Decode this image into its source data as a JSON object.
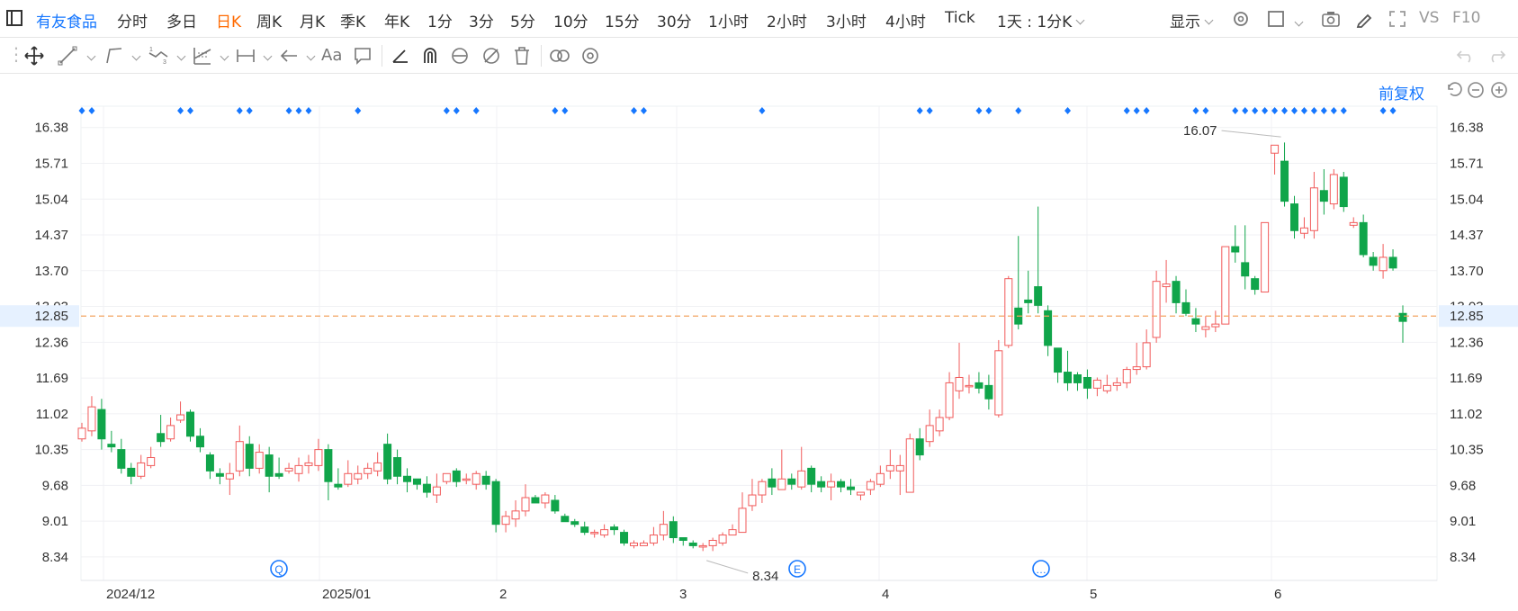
{
  "stock": {
    "name": "有友食品"
  },
  "periods": [
    "分时",
    "多日",
    "日K",
    "周K",
    "月K",
    "季K",
    "年K",
    "1分",
    "3分",
    "5分",
    "10分",
    "15分",
    "30分",
    "1小时",
    "2小时",
    "3小时",
    "4小时",
    "Tick"
  ],
  "active_period": "日K",
  "period_select": "1天 : 1分K",
  "display_label": "显示",
  "vs_label": "VS",
  "f10_label": "F10",
  "adjust_label": "前复权",
  "text_tool_label": "Aa",
  "icons": [
    "sidebar-toggle-icon",
    "settings-icon",
    "rectangle-icon",
    "camera-icon",
    "pencil-icon",
    "fullscreen-icon",
    "undo-icon",
    "redo-icon",
    "crosshair-move-icon",
    "line-icon",
    "channel-icon",
    "wave-icon",
    "fib-icon",
    "measure-icon",
    "arrow-icon",
    "text-icon",
    "comment-icon",
    "angle-icon",
    "magnet-icon",
    "eye-lock-icon",
    "hide-icon",
    "trash-icon",
    "link-icon",
    "gear-icon",
    "reset-icon",
    "zoom-out-icon",
    "zoom-in-icon"
  ],
  "colors": {
    "up": "#f15a5a",
    "down": "#10a54a",
    "accent": "#1677ff",
    "active": "#ff6a00",
    "price_line": "#f4a460"
  },
  "chart_data": {
    "type": "candlestick",
    "y_ticks": [
      "16.38",
      "15.71",
      "15.04",
      "14.37",
      "13.70",
      "13.03",
      "12.36",
      "11.69",
      "11.02",
      "10.35",
      "9.68",
      "9.01",
      "8.34"
    ],
    "ylim": [
      7.9,
      16.78
    ],
    "x_ticks": [
      "2024/12",
      "2025/01",
      "2",
      "3",
      "4",
      "5",
      "6"
    ],
    "current_price": "12.85",
    "high_label": "16.07",
    "low_label": "8.34",
    "event_markers": [
      "Q",
      "E",
      "…"
    ],
    "candles": [
      [
        10.55,
        10.75,
        10.85,
        10.5
      ],
      [
        10.7,
        11.15,
        11.35,
        10.6
      ],
      [
        11.1,
        10.55,
        11.3,
        10.35
      ],
      [
        10.45,
        10.4,
        10.7,
        10.3
      ],
      [
        10.35,
        10.0,
        10.55,
        9.9
      ],
      [
        10.0,
        9.85,
        10.1,
        9.7
      ],
      [
        9.85,
        10.1,
        10.25,
        9.8
      ],
      [
        10.05,
        10.2,
        10.4,
        10.0
      ],
      [
        10.65,
        10.5,
        11.0,
        10.4
      ],
      [
        10.55,
        10.8,
        10.95,
        10.5
      ],
      [
        10.9,
        11.0,
        11.25,
        10.85
      ],
      [
        11.05,
        10.6,
        11.1,
        10.5
      ],
      [
        10.6,
        10.4,
        10.75,
        10.3
      ],
      [
        10.25,
        9.95,
        10.3,
        9.8
      ],
      [
        9.9,
        9.85,
        10.0,
        9.7
      ],
      [
        9.8,
        9.9,
        10.1,
        9.5
      ],
      [
        9.95,
        10.5,
        10.8,
        9.85
      ],
      [
        10.45,
        10.0,
        10.6,
        9.85
      ],
      [
        10.0,
        10.3,
        10.45,
        9.9
      ],
      [
        10.25,
        9.85,
        10.4,
        9.55
      ],
      [
        9.9,
        9.85,
        10.2,
        9.8
      ],
      [
        9.95,
        10.0,
        10.1,
        9.9
      ],
      [
        9.9,
        10.05,
        10.2,
        9.75
      ],
      [
        10.05,
        10.1,
        10.25,
        9.9
      ],
      [
        10.05,
        10.35,
        10.55,
        9.95
      ],
      [
        10.35,
        9.75,
        10.45,
        9.4
      ],
      [
        9.7,
        9.65,
        10.0,
        9.6
      ],
      [
        9.7,
        9.9,
        10.15,
        9.65
      ],
      [
        9.8,
        9.9,
        10.05,
        9.7
      ],
      [
        9.9,
        10.0,
        10.1,
        9.8
      ],
      [
        9.95,
        10.1,
        10.3,
        9.85
      ],
      [
        10.45,
        9.8,
        10.65,
        9.7
      ],
      [
        10.2,
        9.85,
        10.35,
        9.7
      ],
      [
        9.85,
        9.75,
        10.0,
        9.55
      ],
      [
        9.8,
        9.7,
        9.8,
        9.6
      ],
      [
        9.7,
        9.55,
        9.85,
        9.45
      ],
      [
        9.5,
        9.65,
        9.9,
        9.35
      ],
      [
        9.75,
        9.9,
        9.9,
        9.7
      ],
      [
        9.95,
        9.75,
        10.0,
        9.65
      ],
      [
        9.8,
        9.8,
        9.9,
        9.7
      ],
      [
        9.7,
        9.9,
        9.95,
        9.6
      ],
      [
        9.85,
        9.7,
        9.95,
        9.6
      ],
      [
        9.75,
        8.95,
        9.8,
        8.8
      ],
      [
        8.95,
        9.1,
        9.2,
        8.8
      ],
      [
        9.05,
        9.2,
        9.4,
        8.9
      ],
      [
        9.2,
        9.45,
        9.7,
        9.1
      ],
      [
        9.45,
        9.35,
        9.5,
        9.35
      ],
      [
        9.35,
        9.5,
        9.55,
        9.25
      ],
      [
        9.4,
        9.2,
        9.5,
        9.15
      ],
      [
        9.1,
        9.0,
        9.15,
        9.0
      ],
      [
        9.0,
        8.95,
        9.05,
        8.9
      ],
      [
        8.9,
        8.8,
        9.0,
        8.75
      ],
      [
        8.8,
        8.8,
        8.85,
        8.7
      ],
      [
        8.75,
        8.85,
        8.95,
        8.7
      ],
      [
        8.9,
        8.85,
        8.95,
        8.75
      ],
      [
        8.8,
        8.6,
        8.85,
        8.55
      ],
      [
        8.55,
        8.6,
        8.65,
        8.5
      ],
      [
        8.55,
        8.6,
        8.65,
        8.55
      ],
      [
        8.6,
        8.75,
        8.9,
        8.55
      ],
      [
        8.75,
        8.95,
        9.2,
        8.65
      ],
      [
        9.0,
        8.7,
        9.1,
        8.6
      ],
      [
        8.7,
        8.65,
        8.7,
        8.55
      ],
      [
        8.6,
        8.55,
        8.65,
        8.5
      ],
      [
        8.55,
        8.55,
        8.6,
        8.45
      ],
      [
        8.55,
        8.65,
        8.7,
        8.45
      ],
      [
        8.6,
        8.75,
        8.8,
        8.55
      ],
      [
        8.75,
        8.85,
        8.95,
        8.75
      ],
      [
        8.8,
        9.25,
        9.55,
        8.8
      ],
      [
        9.3,
        9.5,
        9.8,
        9.2
      ],
      [
        9.5,
        9.75,
        9.8,
        9.35
      ],
      [
        9.8,
        9.65,
        10.0,
        9.5
      ],
      [
        9.6,
        9.8,
        10.35,
        9.6
      ],
      [
        9.8,
        9.7,
        9.9,
        9.6
      ],
      [
        9.65,
        9.95,
        10.4,
        9.6
      ],
      [
        10.0,
        9.7,
        10.05,
        9.55
      ],
      [
        9.75,
        9.65,
        9.85,
        9.55
      ],
      [
        9.65,
        9.75,
        9.9,
        9.4
      ],
      [
        9.75,
        9.65,
        9.8,
        9.55
      ],
      [
        9.65,
        9.6,
        9.8,
        9.5
      ],
      [
        9.5,
        9.55,
        9.55,
        9.4
      ],
      [
        9.6,
        9.75,
        9.8,
        9.5
      ],
      [
        9.7,
        9.9,
        10.05,
        9.65
      ],
      [
        9.95,
        10.05,
        10.35,
        9.8
      ],
      [
        9.95,
        10.05,
        10.25,
        9.5
      ],
      [
        9.55,
        10.55,
        10.65,
        9.55
      ],
      [
        10.55,
        10.25,
        10.75,
        10.15
      ],
      [
        10.5,
        10.8,
        11.1,
        10.4
      ],
      [
        10.7,
        10.95,
        11.1,
        10.6
      ],
      [
        10.95,
        11.6,
        11.8,
        10.9
      ],
      [
        11.45,
        11.7,
        12.35,
        11.3
      ],
      [
        11.55,
        11.55,
        11.75,
        11.4
      ],
      [
        11.6,
        11.5,
        11.8,
        11.4
      ],
      [
        11.55,
        11.3,
        11.75,
        11.1
      ],
      [
        11.0,
        12.2,
        12.4,
        10.95
      ],
      [
        12.3,
        13.55,
        13.6,
        12.25
      ],
      [
        13.0,
        12.7,
        14.35,
        12.6
      ],
      [
        13.15,
        13.1,
        13.7,
        12.9
      ],
      [
        13.4,
        13.05,
        14.9,
        12.9
      ],
      [
        12.95,
        12.3,
        13.05,
        12.1
      ],
      [
        12.25,
        11.8,
        12.25,
        11.6
      ],
      [
        11.8,
        11.6,
        12.2,
        11.45
      ],
      [
        11.75,
        11.6,
        11.8,
        11.45
      ],
      [
        11.7,
        11.5,
        11.85,
        11.3
      ],
      [
        11.5,
        11.65,
        11.7,
        11.35
      ],
      [
        11.45,
        11.55,
        11.75,
        11.4
      ],
      [
        11.55,
        11.6,
        11.7,
        11.45
      ],
      [
        11.6,
        11.85,
        11.9,
        11.5
      ],
      [
        11.85,
        11.9,
        12.35,
        11.75
      ],
      [
        11.9,
        12.35,
        12.6,
        11.85
      ],
      [
        12.45,
        13.5,
        13.7,
        12.35
      ],
      [
        13.4,
        13.45,
        13.9,
        13.1
      ],
      [
        13.5,
        13.1,
        13.6,
        12.9
      ],
      [
        13.1,
        12.9,
        13.35,
        12.85
      ],
      [
        12.8,
        12.7,
        13.0,
        12.55
      ],
      [
        12.6,
        12.65,
        12.85,
        12.45
      ],
      [
        12.65,
        12.7,
        12.95,
        12.55
      ],
      [
        12.7,
        14.15,
        14.15,
        12.7
      ],
      [
        14.15,
        14.05,
        14.55,
        13.85
      ],
      [
        13.85,
        13.6,
        14.55,
        13.35
      ],
      [
        13.55,
        13.35,
        13.6,
        13.25
      ],
      [
        13.3,
        14.6,
        14.6,
        13.3
      ],
      [
        15.9,
        16.05,
        16.05,
        15.5
      ],
      [
        15.75,
        15.0,
        16.1,
        14.9
      ],
      [
        14.95,
        14.45,
        15.1,
        14.3
      ],
      [
        14.4,
        14.5,
        14.7,
        14.3
      ],
      [
        14.45,
        15.25,
        15.55,
        14.3
      ],
      [
        15.2,
        15.0,
        15.6,
        14.75
      ],
      [
        14.95,
        15.5,
        15.6,
        14.85
      ],
      [
        15.45,
        14.9,
        15.55,
        14.8
      ],
      [
        14.55,
        14.6,
        14.7,
        14.5
      ],
      [
        14.6,
        14.0,
        14.75,
        13.95
      ],
      [
        13.95,
        13.8,
        14.05,
        13.7
      ],
      [
        13.7,
        13.95,
        14.2,
        13.55
      ],
      [
        13.95,
        13.75,
        14.1,
        13.7
      ],
      [
        12.9,
        12.75,
        13.05,
        12.35
      ]
    ]
  }
}
